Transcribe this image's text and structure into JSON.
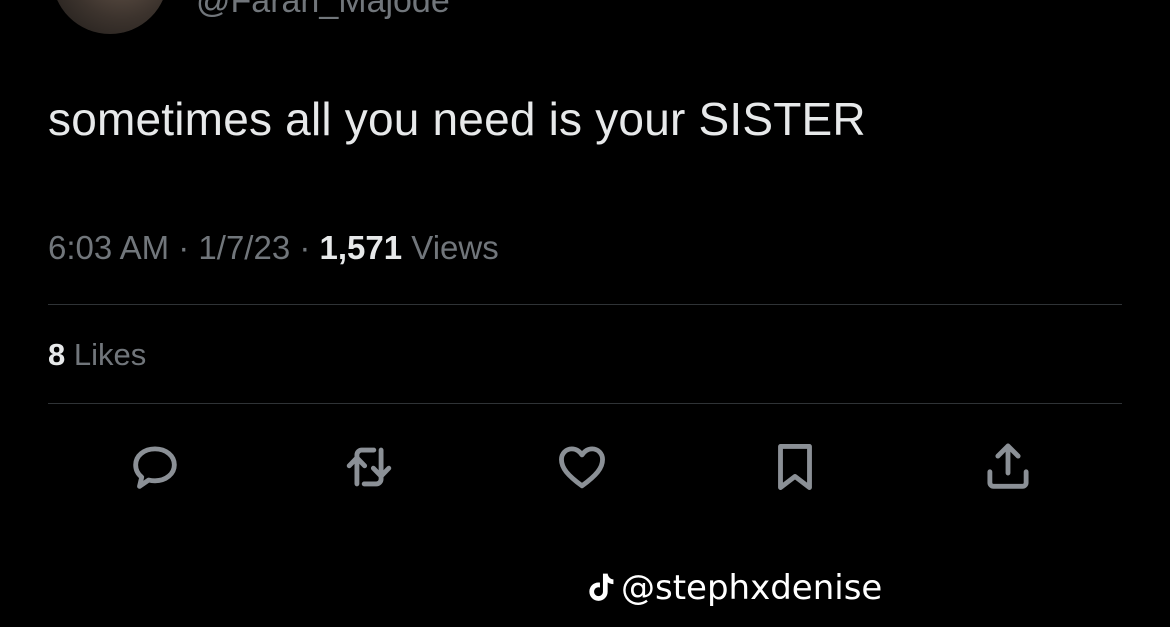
{
  "tweet": {
    "handle": "@Farah_Majode",
    "text": "sometimes all you need is your SISTER",
    "time": "6:03 AM",
    "date": "1/7/23",
    "separator": "·",
    "views_count": "1,571",
    "views_label": "Views",
    "likes_count": "8",
    "likes_label": "Likes"
  },
  "actions": {
    "reply_icon": "reply-icon",
    "retweet_icon": "retweet-icon",
    "like_icon": "heart-icon",
    "bookmark_icon": "bookmark-icon",
    "share_icon": "share-icon"
  },
  "watermark": {
    "logo_icon": "tiktok-icon",
    "text": "@stephxdenise"
  },
  "colors": {
    "background": "#000000",
    "primary_text": "#e7e9ea",
    "secondary_text": "#71767b",
    "divider": "#2f3336",
    "icon": "#8b9096"
  }
}
